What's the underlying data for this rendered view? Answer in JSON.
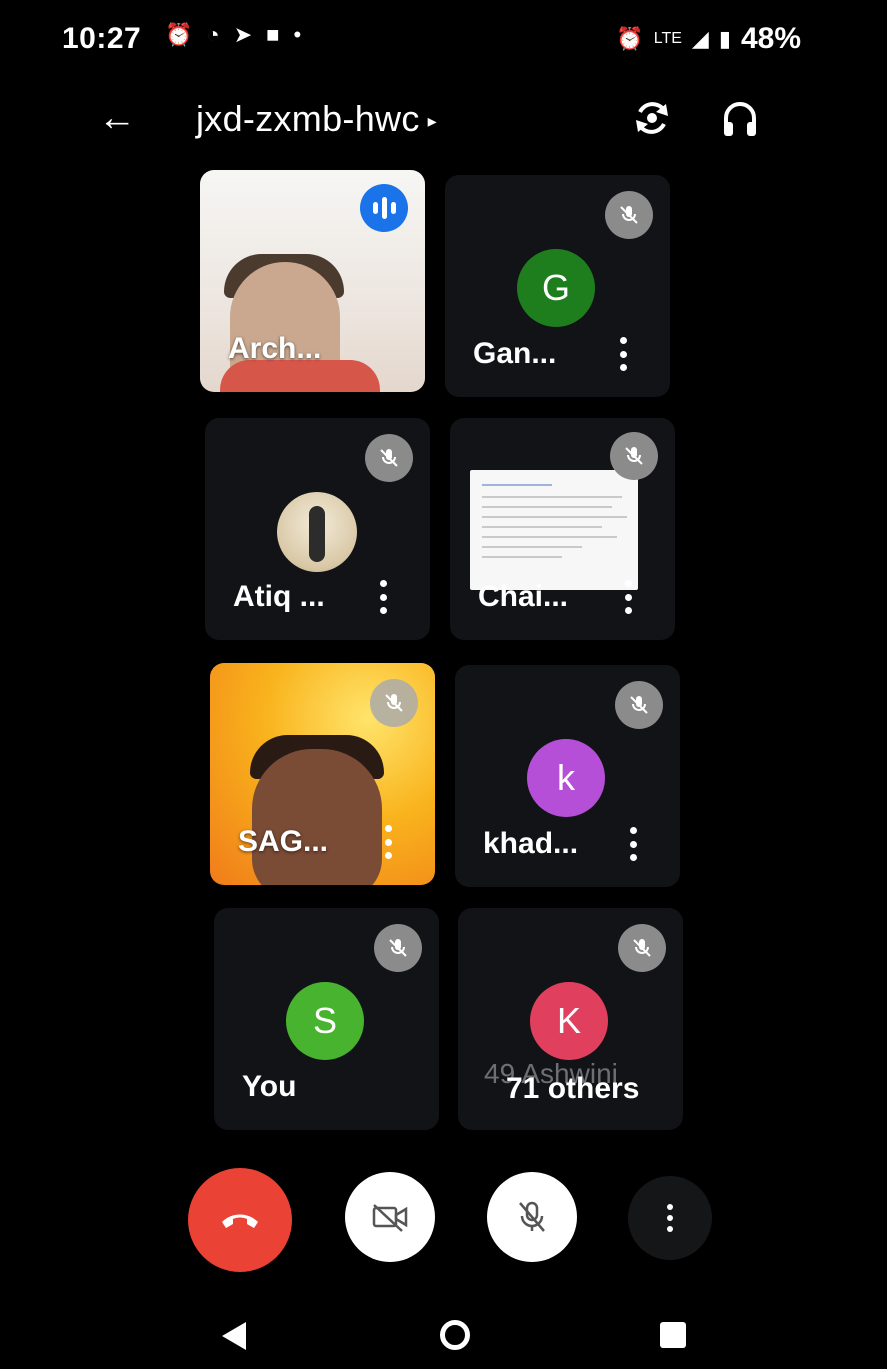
{
  "status_bar": {
    "time": "10:27",
    "network": "LTE",
    "battery": "48%"
  },
  "header": {
    "meeting_code": "jxd-zxmb-hwc",
    "icons": [
      "back-arrow-icon",
      "switch-camera-icon",
      "headphones-icon"
    ]
  },
  "participants": [
    {
      "name": "Arch...",
      "type": "video",
      "speaking": true,
      "muted": false
    },
    {
      "name": "Gan...",
      "type": "avatar",
      "initial": "G",
      "avatar_color": "#1e7e1e",
      "muted": true
    },
    {
      "name": "Atiq ...",
      "type": "photo",
      "muted": true
    },
    {
      "name": "Chai...",
      "type": "screen",
      "muted": true
    },
    {
      "name": "SAG...",
      "type": "video",
      "muted": true
    },
    {
      "name": "khad...",
      "type": "avatar",
      "initial": "k",
      "avatar_color": "#b64fd8",
      "muted": true
    },
    {
      "name": "You",
      "type": "avatar",
      "initial": "S",
      "avatar_color": "#47b32e",
      "muted": true
    },
    {
      "name": "71 others",
      "type": "avatar",
      "initial": "K",
      "avatar_color": "#e0405d",
      "muted": true,
      "background_text": "49 Ashwini"
    }
  ],
  "controls": {
    "buttons": [
      "end-call",
      "camera-off",
      "mic-off",
      "more-options"
    ],
    "colors": {
      "end_call": "#ea4335",
      "toggle": "#ffffff"
    }
  },
  "nav_bar": [
    "back",
    "home",
    "recents"
  ]
}
